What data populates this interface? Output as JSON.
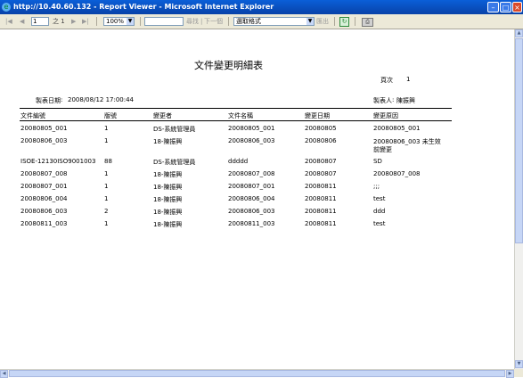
{
  "window": {
    "title": "http://10.40.60.132 - Report Viewer - Microsoft Internet Explorer"
  },
  "toolbar": {
    "first_page": "|◀",
    "prev_page": "◀",
    "page_input": "1",
    "of_label": "之 1",
    "next_page": "▶",
    "last_page": "▶|",
    "zoom": "100%",
    "search_placeholder": "",
    "find_label": "尋找",
    "find_next_label": "下一個",
    "export_format": "選取格式",
    "export_label": "匯出"
  },
  "report": {
    "title": "文件變更明細表",
    "page_label": "頁次",
    "page_number": "1",
    "date_label": "製表日期",
    "date_value": "2008/08/12 17:00:44",
    "creator_label": "製表人",
    "creator_value": "陳振興",
    "columns": [
      "文件編號",
      "版號",
      "變更者",
      "文件名稱",
      "變更日期",
      "變更原因"
    ],
    "rows": [
      [
        "20080805_001",
        "1",
        "DS-系統管理員",
        "20080805_001",
        "20080805",
        [
          "20080805_001"
        ]
      ],
      [
        "20080806_003",
        "1",
        "18-陳振興",
        "20080806_003",
        "20080806",
        [
          "20080806_003 未生效",
          "前變更"
        ]
      ],
      [
        "ISOE-12130ISO9001003",
        "88",
        "DS-系統管理員",
        "ddddd",
        "20080807",
        [
          "SD"
        ]
      ],
      [
        "20080807_008",
        "1",
        "18-陳振興",
        "20080807_008",
        "20080807",
        [
          "20080807_008"
        ]
      ],
      [
        "20080807_001",
        "1",
        "18-陳振興",
        "20080807_001",
        "20080811",
        [
          ";;;"
        ]
      ],
      [
        "20080806_004",
        "1",
        "18-陳振興",
        "20080806_004",
        "20080811",
        [
          "test"
        ]
      ],
      [
        "20080806_003",
        "2",
        "18-陳振興",
        "20080806_003",
        "20080811",
        [
          "ddd"
        ]
      ],
      [
        "20080811_003",
        "1",
        "18-陳振興",
        "20080811_003",
        "20080811",
        [
          "test"
        ]
      ]
    ]
  }
}
